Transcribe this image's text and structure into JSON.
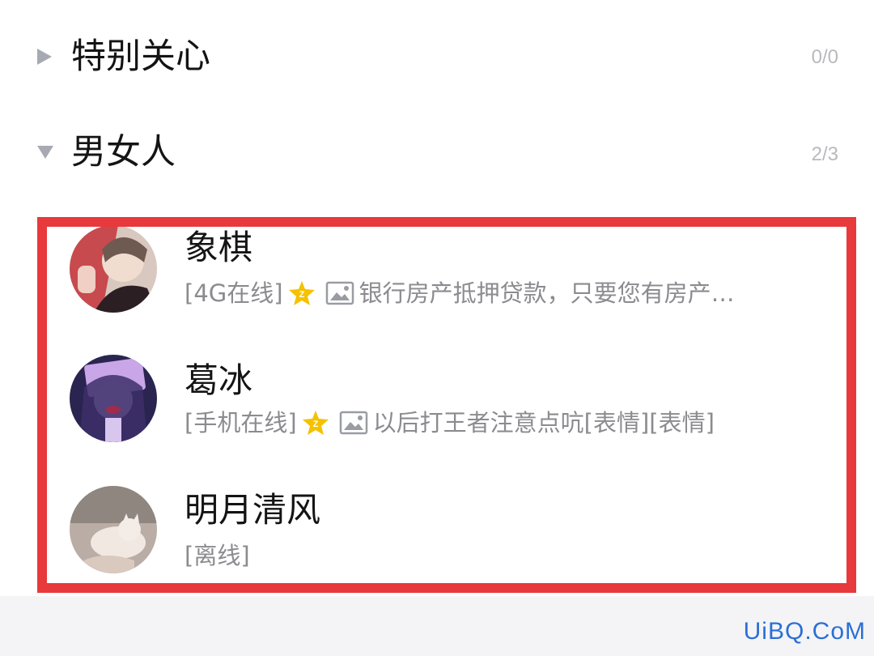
{
  "groups": [
    {
      "name": "特别关心",
      "count": "0/0",
      "expanded": false
    },
    {
      "name": "男女人",
      "count": "2/3",
      "expanded": true
    }
  ],
  "contacts": [
    {
      "name": "象棋",
      "status": "[4G在线]",
      "message": "银行房产抵押贷款，只要您有房产…",
      "has_badge": true
    },
    {
      "name": "葛冰",
      "status": "[手机在线]",
      "message": "以后打王者注意点吭[表情][表情]",
      "has_badge": true
    },
    {
      "name": "明月清风",
      "status": "[离线]",
      "message": "",
      "has_badge": false
    }
  ],
  "watermark": "UiBQ.CoM",
  "colors": {
    "highlight": "#e8393c",
    "secondary_text": "#8b8b90",
    "count_text": "#b9b9be",
    "badge": "#f4c200"
  },
  "icons": [
    "triangle-right-icon",
    "triangle-down-icon",
    "vip-star-icon",
    "image-icon"
  ]
}
